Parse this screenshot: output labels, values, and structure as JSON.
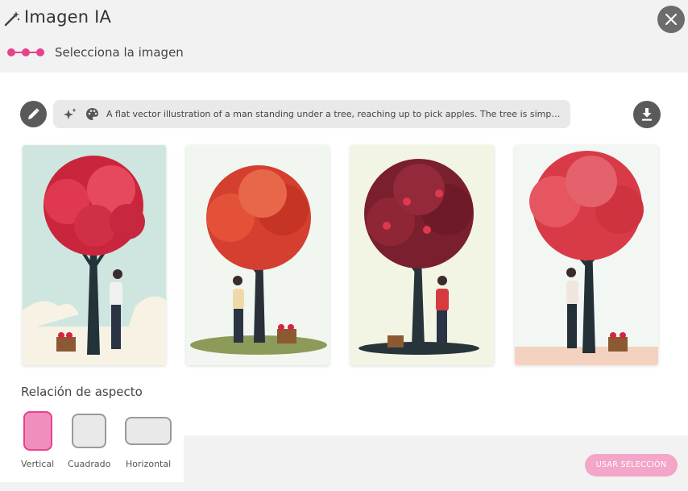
{
  "header": {
    "title": "Imagen IA",
    "wand_icon": "magic-wand-icon",
    "close_icon": "close-icon"
  },
  "steps": {
    "subtitle": "Selecciona la imagen",
    "accent_color": "#e6428e"
  },
  "prompt": {
    "text": "A flat vector illustration of a man standing under a tree, reaching up to pick apples. The tree is simple a...",
    "icons": [
      "sparkle-icon",
      "palette-icon"
    ]
  },
  "toolbar": {
    "edit_icon": "pencil-icon",
    "download_icon": "download-icon"
  },
  "images": [
    {
      "name": "apple-tree-image-1"
    },
    {
      "name": "apple-tree-image-2"
    },
    {
      "name": "apple-tree-image-3"
    },
    {
      "name": "apple-tree-image-4"
    }
  ],
  "aspect": {
    "label": "Relación de aspecto",
    "options": [
      {
        "label": "Vertical",
        "selected": true
      },
      {
        "label": "Cuadrado",
        "selected": false
      },
      {
        "label": "Horizontal",
        "selected": false
      }
    ]
  },
  "actions": {
    "use_selection": "USAR SELECCIÓN",
    "button_color": "#f3a6c7"
  }
}
